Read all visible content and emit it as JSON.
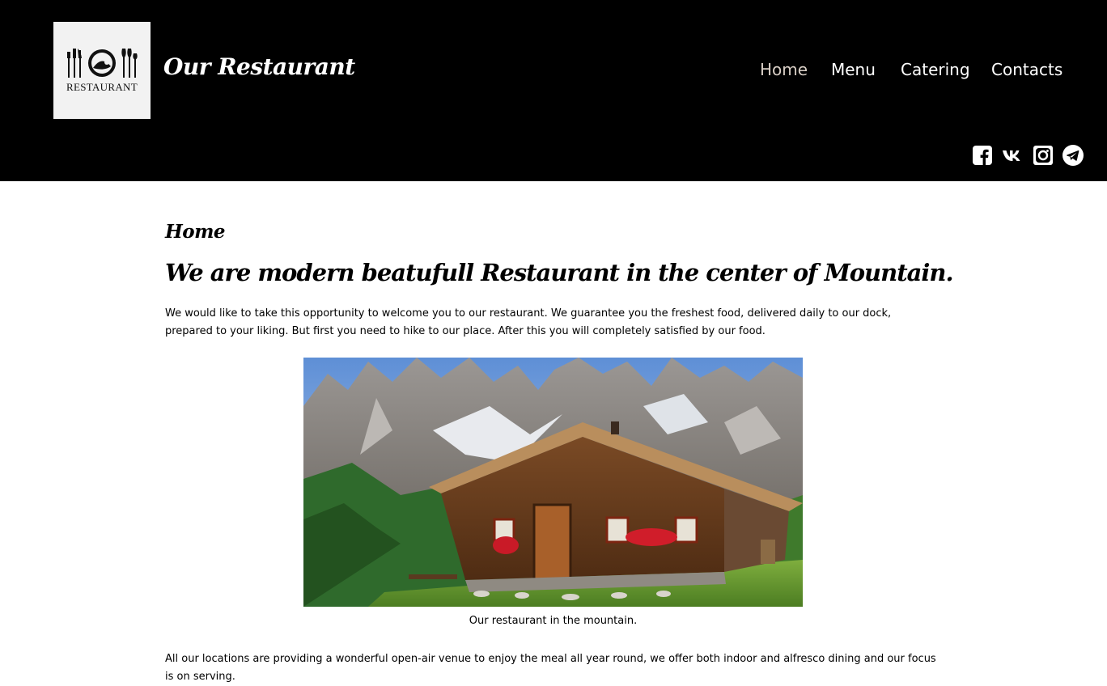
{
  "header": {
    "logo_text": "RESTAURANT",
    "brand": "Our Restaurant",
    "nav": [
      {
        "label": "Home",
        "active": true
      },
      {
        "label": "Menu",
        "active": false
      },
      {
        "label": "Catering",
        "active": false
      },
      {
        "label": "Contacts",
        "active": false
      }
    ],
    "social_icons": [
      "facebook-icon",
      "vk-icon",
      "instagram-icon",
      "telegram-icon"
    ]
  },
  "main": {
    "page_heading": "Home",
    "headline": "We are modern beatufull Restaurant in the center of Mountain.",
    "intro": "We would like to take this opportunity to welcome you to our restaurant. We guarantee you the freshest food, delivered daily to our dock, prepared to your liking. But first you need to hike to our place. After this you will completely satisfied by our food.",
    "caption": "Our restaurant in the mountain.",
    "outro": "All our locations are providing a wonderful open-air venue to enjoy the meal all year round, we offer both indoor and alfresco dining and our focus is on serving."
  },
  "colors": {
    "header_bg": "#000000",
    "nav_active": "#d9cfc6",
    "nav_text": "#ffffff",
    "page_bg": "#ffffff"
  }
}
